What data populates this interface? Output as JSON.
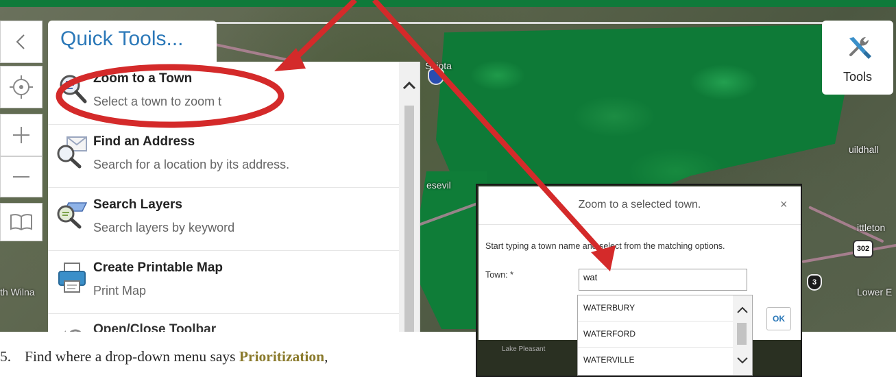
{
  "map": {
    "labels": {
      "sciota": "Sciota",
      "wilna": "th Wilna",
      "esevil": "esevil",
      "guildhall": "uildhall",
      "ittleton": "ittleton",
      "lower": "Lower E",
      "lake_pleasant": "Lake Pleasant"
    },
    "shields": {
      "route_302": "302",
      "route_3": "3"
    }
  },
  "controls": {
    "back_icon": "chevron-left-icon",
    "locate_icon": "crosshair-icon",
    "zoom_in_icon": "plus-icon",
    "zoom_out_icon": "minus-icon",
    "book_icon": "book-icon"
  },
  "quick_tools": {
    "title": "Quick Tools...",
    "items": [
      {
        "title": "Zoom to a Town",
        "desc": "Select a town to zoom t",
        "icon": "magnifier-list-icon"
      },
      {
        "title": "Find an Address",
        "desc": "Search for a location by its address.",
        "icon": "magnifier-envelope-icon"
      },
      {
        "title": "Search Layers",
        "desc": "Search layers by keyword",
        "icon": "magnifier-layers-icon"
      },
      {
        "title": "Create Printable Map",
        "desc": "Print Map",
        "icon": "printer-icon"
      },
      {
        "title": "Open/Close Toolbar",
        "desc": "",
        "icon": "toolbar-icon"
      }
    ]
  },
  "tools_button": {
    "label": "Tools",
    "icon": "wrench-screwdriver-icon"
  },
  "dialog": {
    "title": "Zoom to a selected town.",
    "close": "×",
    "instructions": "Start typing a town name and select from the matching options.",
    "town_label": "Town: *",
    "town_value": "wat",
    "ok_label": "OK",
    "options": [
      "WATERBURY",
      "WATERFORD",
      "WATERVILLE"
    ]
  },
  "instruction": {
    "number": "5.",
    "text_before": "Find where a drop-down menu says ",
    "keyword": "Prioritization",
    "text_after": ","
  },
  "colors": {
    "accent_blue": "#2b78b8",
    "annotation_red": "#d42a2a",
    "keyword_olive": "#8a7a2c",
    "map_green": "#0e7a37"
  }
}
